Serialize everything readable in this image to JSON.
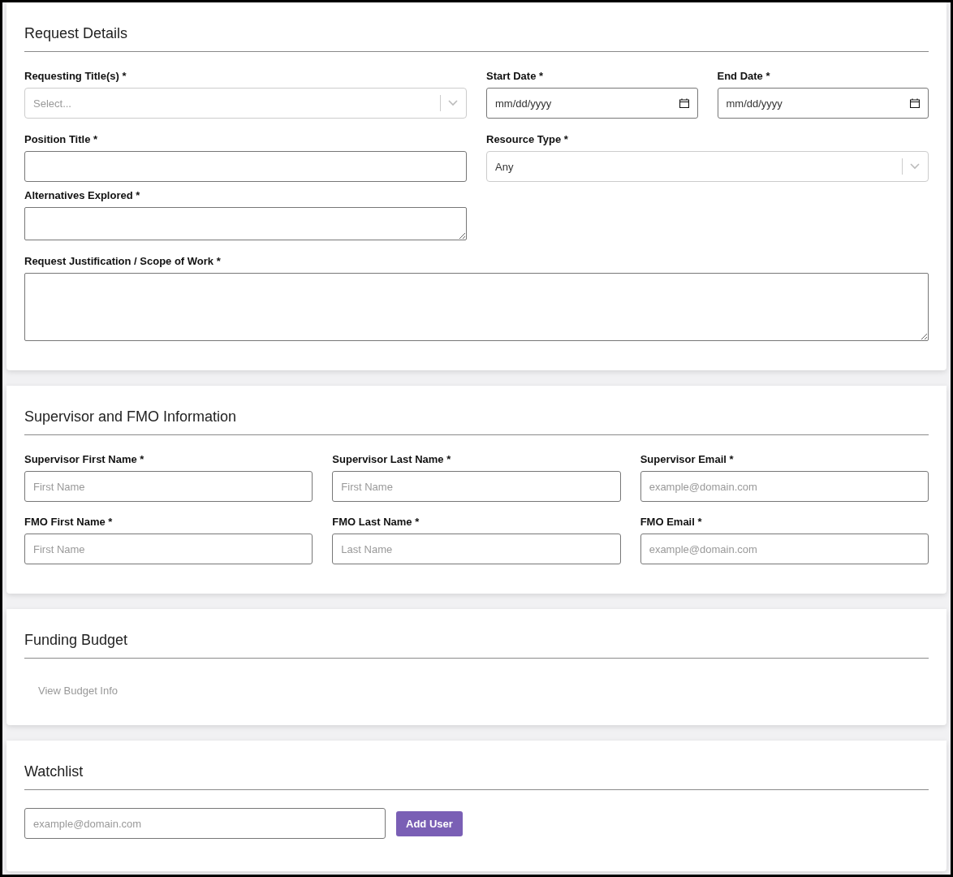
{
  "request_details": {
    "title": "Request Details",
    "requesting_titles": {
      "label": "Requesting Title(s) *",
      "placeholder": "Select..."
    },
    "start_date": {
      "label": "Start Date *",
      "placeholder": "mm/dd/yyyy"
    },
    "end_date": {
      "label": "End Date *",
      "placeholder": "mm/dd/yyyy"
    },
    "position_title": {
      "label": "Position Title *"
    },
    "resource_type": {
      "label": "Resource Type *",
      "value": "Any"
    },
    "alternatives_explored": {
      "label": "Alternatives Explored *"
    },
    "justification": {
      "label": "Request Justification / Scope of Work *"
    }
  },
  "supervisor_fmo": {
    "title": "Supervisor and FMO Information",
    "fields": [
      {
        "label": "Supervisor First Name *",
        "placeholder": "First Name"
      },
      {
        "label": "Supervisor Last Name *",
        "placeholder": "First Name"
      },
      {
        "label": "Supervisor Email *",
        "placeholder": "example@domain.com"
      },
      {
        "label": "FMO First Name *",
        "placeholder": "First Name"
      },
      {
        "label": "FMO Last Name *",
        "placeholder": "Last Name"
      },
      {
        "label": "FMO Email *",
        "placeholder": "example@domain.com"
      }
    ]
  },
  "funding_budget": {
    "title": "Funding Budget",
    "link": "View Budget Info"
  },
  "watchlist": {
    "title": "Watchlist",
    "placeholder": "example@domain.com",
    "button": "Add User"
  }
}
